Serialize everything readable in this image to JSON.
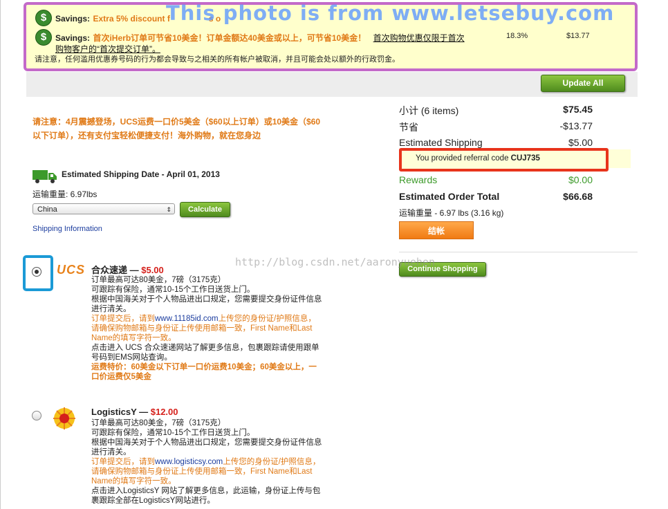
{
  "watermark_top": "This photo is from www.letsebuy.com",
  "watermark_csdn": "http://blog.csdn.net/aaronyuehen",
  "savings": {
    "row1_label": "Savings:",
    "row1_text": "Extra 5% discount f",
    "row1_tail": "s o",
    "row2_label": "Savings:",
    "row2_text": "首次iHerb订单可节省10美金！订单金额达40美金或以上，可节省10美金！",
    "row2_link_1": "首次购物优惠仅限于首次",
    "row2_link_2": "购物客户的“首次提交订单”。",
    "row2_percent": "18.3%",
    "row2_amount": "$13.77",
    "warning": "请注意，任何滥用优惠券号码的行为都会导致与之相关的所有帐户被取消，并且可能会处以额外的行政罚金。",
    "icon": "dollar-icon"
  },
  "update_all_label": "Update All",
  "notice": {
    "line1": "请注意：4月震撼登场，UCS运费一口价5美金（$60以上订单）或10美金（$60",
    "line2": "以下订单），还有支付宝轻松便捷支付！海外购物，就在您身边"
  },
  "shipping": {
    "truck_icon": "truck-icon",
    "date_label": "Estimated Shipping Date - April 01, 2013",
    "weight_label": "运输重量: 6.97lbs",
    "country": "China",
    "calculate_label": "Calculate",
    "info_link": "Shipping Information"
  },
  "summary": {
    "subtotal_label": "小计 (6 items)",
    "subtotal_value": "$75.45",
    "savings_label": "节省",
    "savings_value": "-$13.77",
    "shipping_label": "Estimated Shipping",
    "shipping_value": "$5.00",
    "referral_prefix": "You provided referral code",
    "referral_code": "CUJ735",
    "rewards_label": "Rewards",
    "rewards_value": "$0.00",
    "total_label": "Estimated Order Total",
    "total_value": "$66.68",
    "weight": "运输重量 - 6.97 lbs (3.16 kg)",
    "checkout_label": "结帐",
    "continue_label": "Continue Shopping"
  },
  "options": [
    {
      "logo": "UCS",
      "title": "合众速递 — ",
      "price": "$5.00",
      "lines": [
        "订单最高可达80美金，7磅（3175克）",
        "可跟踪有保险，通常10-15个工作日送货上门。",
        "根据中国海关对于个人物品进出口规定，您需要提交身份证件信息",
        "进行清关。"
      ],
      "orange_1a": "订单提交后，请到",
      "orange_1link": "www.11185id.com",
      "orange_1b": "上传您的身份证/护照信息，",
      "orange_2": "请确保购物邮箱与身份证上传使用邮箱一致，First Name和Last",
      "orange_3": "Name的填写字符一致。",
      "lines2": [
        "点击进入 UCS 合众速递网站了解更多信息，包裹跟踪请使用跟单",
        "号码到EMS网站查询。"
      ],
      "special_1": "运费特价：60美金以下订单一口价运费10美金；60美金以上，一",
      "special_2": "口价运费仅5美金"
    },
    {
      "logo_icon": "logisticsy-logo-icon",
      "title": "LogisticsY — ",
      "price": "$12.00",
      "lines": [
        "订单最高可达80美金，7磅（3175克）",
        "可跟踪有保险，通常10-15个工作日送货上门。",
        "根据中国海关对于个人物品进出口规定，您需要提交身份证件信息",
        "进行清关。"
      ],
      "orange_1a": "订单提交后，请到",
      "orange_1link": "www.logisticsy.com",
      "orange_1b": "上传您的身份证/护照信息，",
      "orange_2": "请确保购物邮箱与身份证上传使用邮箱一致，First Name和Last",
      "orange_3": "Name的填写字符一致。",
      "lines2": [
        "点击进入LogisticsY 网站了解更多信息，此运输，身份证上传与包",
        "裹跟踪全部在LogisticsY网站进行。"
      ]
    }
  ]
}
